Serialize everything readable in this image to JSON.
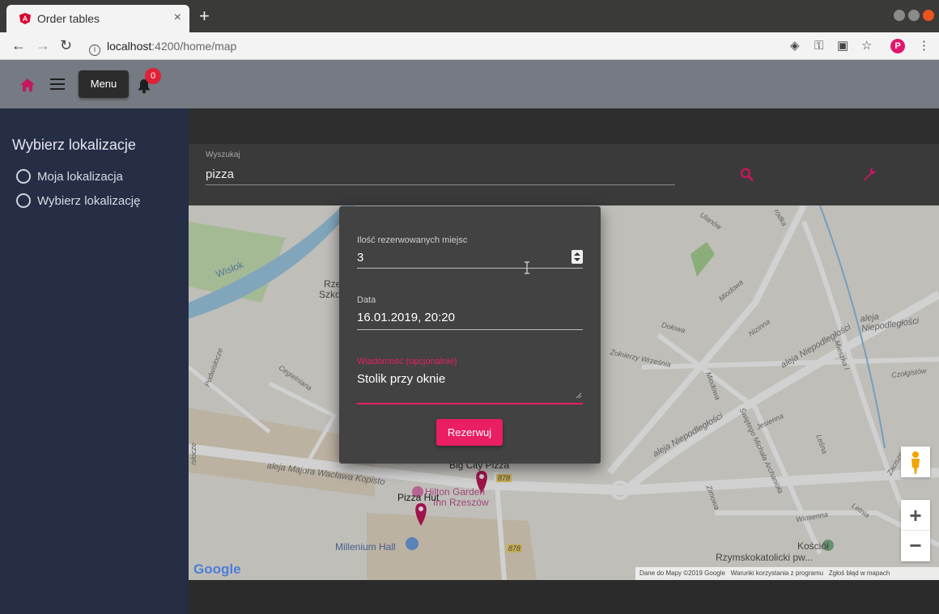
{
  "browser": {
    "tab_title": "Order tables",
    "url_host": "localhost",
    "url_path": ":4200/home/map",
    "profile_initial": "P"
  },
  "toolbar": {
    "menu_label": "Menu",
    "notifications_count": "0"
  },
  "sidebar": {
    "title": "Wybierz lokalizacje",
    "options": [
      {
        "label": "Moja lokalizacja"
      },
      {
        "label": "Wybierz lokalizację"
      }
    ]
  },
  "search": {
    "label": "Wyszukaj",
    "value": "pizza"
  },
  "dialog": {
    "seats_label": "Ilość rezerwowanych miejsc",
    "seats_value": "3",
    "date_label": "Data",
    "date_value": "16.01.2019, 20:20",
    "message_label": "Wiadomość (opcjonalnie)",
    "message_value": "Stolik przy oknie",
    "submit_label": "Rezerwuj"
  },
  "map": {
    "labels": {
      "wislok": "Wisłok",
      "rze": "Rze",
      "szko": "Szko",
      "big_city_pizza": "Big City Pizza",
      "pizza_hut": "Pizza Hut",
      "hilton": "Hilton Garden",
      "hilton2": "Inn Rzeszów",
      "millenium": "Millenium Hall",
      "kosciol1": "Kościół",
      "kosciol2": "Rzymskokatolicki pw...",
      "road_878a": "878",
      "road_878b": "878",
      "road_878c": "878"
    },
    "streets": {
      "ulanow": "Ulanów",
      "miodowa": "Miodowa",
      "dolowa": "Dołowa",
      "nizinna": "Nizinna",
      "niepodleglosci1": "aleja Niepodległości",
      "niepodleglosci2": "aleja Niepodległości",
      "niepodleglosci3": "aleja Niepodległości",
      "mieszka": "Mieszka I",
      "czolgistow": "Czołgistów",
      "wrzesnia": "Żołnierzy Września",
      "miodowa2": "Miodowa",
      "jesienna": "Jesienna",
      "archaniola": "Świętego Michała Archanioła",
      "lesna": "Leśna",
      "zimowa": "Zimowa",
      "wiosenna": "Wiosenna",
      "letnia": "Letnia",
      "podwislocze": "Podwisłocze",
      "cegielniana": "Cegielniana",
      "majora": "aleja Majora Wacława Kopisto",
      "islocze": "isłocze",
      "zaciszna": "Zaciszna",
      "rodka": "rodka"
    },
    "google_logo": "Google",
    "attribution": "Dane do Mapy ©2019 Google",
    "terms": "Warunki korzystania z programu",
    "report": "Zgłoś błąd w mapach",
    "zoom_in": "+",
    "zoom_out": "−"
  },
  "colors": {
    "accent": "#e91e63",
    "sidebar_bg": "#262e45",
    "toolbar_bg": "#767a82"
  }
}
